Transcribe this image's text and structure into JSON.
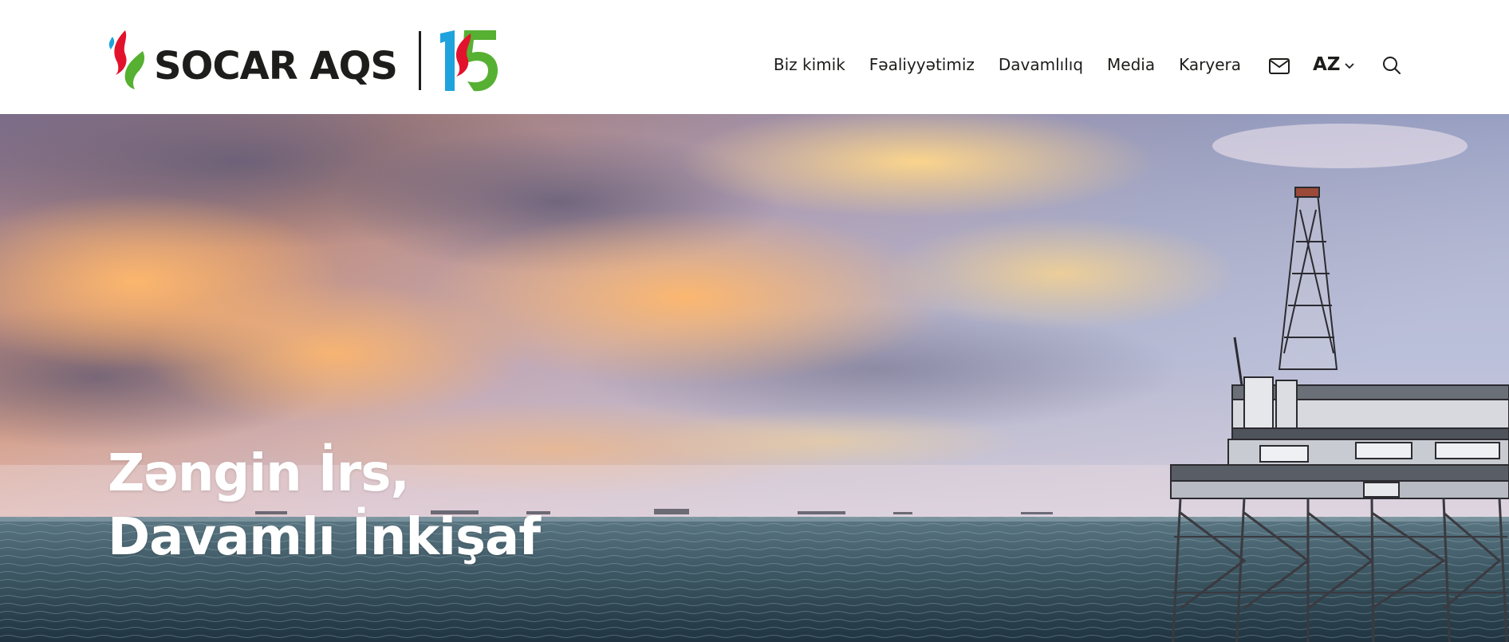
{
  "brand": {
    "name": "SOCAR AQS",
    "anniversary": "15",
    "colors": {
      "red": "#e3122c",
      "green": "#56b031",
      "blue": "#1ea3dd",
      "dark": "#1d1d1b"
    }
  },
  "nav": {
    "items": [
      {
        "label": "Biz kimik"
      },
      {
        "label": "Fəaliyyətimiz"
      },
      {
        "label": "Davamlılıq"
      },
      {
        "label": "Media"
      },
      {
        "label": "Karyera"
      }
    ],
    "mail_icon": "mail-icon",
    "language": "AZ",
    "language_icon": "chevron-down-icon",
    "search_icon": "search-icon"
  },
  "hero": {
    "title_line1": "Zəngin İrs,",
    "title_line2": "Davamlı İnkişaf",
    "image": "offshore-oil-platform-at-sunset"
  }
}
